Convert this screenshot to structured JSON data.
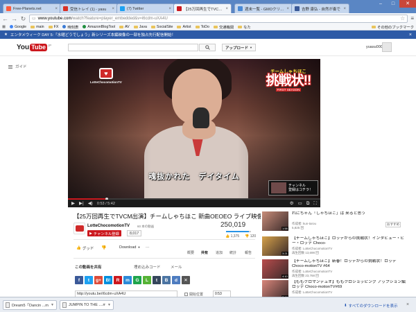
{
  "browser": {
    "tabs": [
      {
        "title": "Free-Planets.net",
        "color": "#ff5a3c"
      },
      {
        "title": "受信トレイ (1) - yasu",
        "color": "#d93025"
      },
      {
        "title": "(7) Twitter",
        "color": "#1da1f2"
      },
      {
        "title": "【25万回再生でTVCM出",
        "color": "#cc181e"
      },
      {
        "title": "週末一覧 - GMOクリック",
        "color": "#4a8ad6"
      },
      {
        "title": "吉野 康弘 - 自然が奏で",
        "color": "#3b5998"
      }
    ],
    "url_host": "www.youtube.com",
    "url_rest": "/watch?feature=player_embedded&v=i6cdm-uXA4U",
    "bookmarks": [
      {
        "label": "Google",
        "kind": "dot",
        "color": "#4285f4"
      },
      {
        "label": "main",
        "kind": "folder"
      },
      {
        "label": "FX",
        "kind": "folder"
      },
      {
        "label": "時刻表",
        "kind": "dot",
        "color": "#3a7bd5"
      },
      {
        "label": "AmazonBlogTool",
        "kind": "dot",
        "color": "#1e8e3e"
      },
      {
        "label": "AV",
        "kind": "folder"
      },
      {
        "label": "Java",
        "kind": "folder"
      },
      {
        "label": "SocialSite",
        "kind": "folder"
      },
      {
        "label": "Artist",
        "kind": "folder"
      },
      {
        "label": "ToDo",
        "kind": "folder"
      },
      {
        "label": "交通機関",
        "kind": "folder"
      },
      {
        "label": "なた",
        "kind": "folder"
      }
    ],
    "other_bookmarks": "その他のブックマーク"
  },
  "youtube": {
    "banner_text": "エンタメウィーク DAY 5:「水曜どうでしょう」新シリーズ本編映像の一部を独占先行配信開始！",
    "logo_you": "You",
    "logo_tube": "Tube",
    "logo_region": "JP",
    "search_placeholder": "",
    "upload_label": "アップロード",
    "username": "yuasu0007",
    "guide_label": "ガイド"
  },
  "player": {
    "channel_logo_text": "LotteChocomotionTV",
    "show_logo_top": "チームしゃちほこ",
    "show_logo_big": "挑戦状!!",
    "show_logo_sub": "FIRST SEASON",
    "subtitle": "魂抜かれた　デイタイム",
    "overlay_text_1": "チャンネル",
    "overlay_text_2": "登録はコチラ！",
    "time_current": "0:53",
    "time_total": "5:42",
    "progress": 0.155
  },
  "video": {
    "title": "【25万回再生でTVCM出演】チームしゃちほこ 新曲OEOEO ライブ映像！",
    "channel_name": "LotteChocomotionTV",
    "channel_video_count": "60 本の動画",
    "subscribe_label": "チャンネル登録",
    "subscriber_count": "8,017",
    "views": "250,019",
    "likes": "1,375",
    "dislikes": "120",
    "like_ratio": 0.92,
    "like_label": "グッド",
    "download_label": "Download",
    "info_tabs": [
      "概要",
      "共有",
      "追加",
      "統計",
      "報告"
    ],
    "share_heading": "この動画を共有",
    "embed_label": "埋め込みコード",
    "email_label": "メール",
    "share_icons": [
      {
        "label": "f",
        "color": "#3b5998",
        "name": "facebook-icon"
      },
      {
        "label": "t",
        "color": "#1da1f2",
        "name": "twitter-icon"
      },
      {
        "label": "g+",
        "color": "#dd4b39",
        "name": "google-plus-icon"
      },
      {
        "label": "B!",
        "color": "#008fde",
        "name": "hatena-icon"
      },
      {
        "label": "R",
        "color": "#cc181e",
        "name": "reddit-icon"
      },
      {
        "label": "m",
        "color": "#2c8ad8",
        "name": "mixi-icon"
      },
      {
        "label": "G",
        "color": "#1ea54c",
        "name": "goo-icon"
      },
      {
        "label": "L",
        "color": "#56b335",
        "name": "line-icon"
      },
      {
        "label": "t",
        "color": "#35465c",
        "name": "tumblr-icon"
      },
      {
        "label": "B",
        "color": "#4c75a3",
        "name": "vk-icon"
      },
      {
        "label": "d",
        "color": "#4e7cc0",
        "name": "digg-icon"
      },
      {
        "label": "✕",
        "color": "#555555",
        "name": "more-share-icon"
      }
    ],
    "short_url": "http://youtu.be/i6cdm-uXA4U",
    "start_at_label": "開始位置",
    "start_time": "0:53"
  },
  "related": [
    {
      "title": "れにちゃん「しゃちほこ」は 来ると思う",
      "meta1": "作成者: kun-tarou",
      "meta2": "5,825 回",
      "badge": "おすすめ",
      "color": "#c98d7a",
      "duration": "1:58"
    },
    {
      "title": "【チームしゃちほこ】ロッテからの挑戦状！インタビュー・ビー・ロッテ Choco-",
      "meta1": "作成者: LotteChocomotionTV",
      "meta2": "再生回数 13,698 回",
      "badge": "",
      "color": "#d6a24a",
      "duration": "3:21"
    },
    {
      "title": "【チームしゃちほこ】新春！ロッテからの挑戦状！ロッテ Choco-motionTV #64",
      "meta1": "作成者: LotteChocomotionTV",
      "meta2": "再生回数 23,768 回",
      "badge": "",
      "color": "#b94d4d",
      "duration": "4:10"
    },
    {
      "title": "【ももクロマンデュオ】ももクロショッピング アップション編 ロッテ Choco-motionTV#69",
      "meta1": "作成者: LotteChocomotionTV",
      "meta2": "",
      "badge": "",
      "color": "#d9867a",
      "duration": "2:44"
    }
  ],
  "downloads": {
    "items": [
      "Dream5『Dancin ...mp4",
      "JUMPIN TO THE ....mp4"
    ],
    "show_all_label": "すべてのダウンロードを表示"
  }
}
